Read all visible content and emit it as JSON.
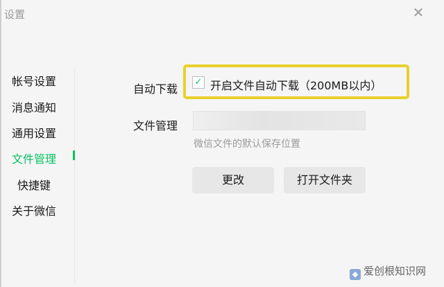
{
  "window": {
    "title": "设置",
    "close_icon": "close-icon"
  },
  "sidebar": {
    "items": [
      {
        "label": "帐号设置",
        "active": false
      },
      {
        "label": "消息通知",
        "active": false
      },
      {
        "label": "通用设置",
        "active": false
      },
      {
        "label": "文件管理",
        "active": true
      },
      {
        "label": "快捷键",
        "active": false
      },
      {
        "label": "关于微信",
        "active": false
      }
    ],
    "active_color": "#07c160"
  },
  "settings": {
    "auto_download": {
      "label": "自动下载",
      "checkbox_checked": true,
      "checkbox_text": "开启文件自动下载（200MB以内）"
    },
    "file_management": {
      "label": "文件管理",
      "path_value": "",
      "hint": "微信文件的默认保存位置"
    },
    "buttons": {
      "change": "更改",
      "open_folder": "打开文件夹"
    }
  },
  "highlight_color": "#e8d12a",
  "watermark": {
    "text": "爱创根知识网"
  }
}
